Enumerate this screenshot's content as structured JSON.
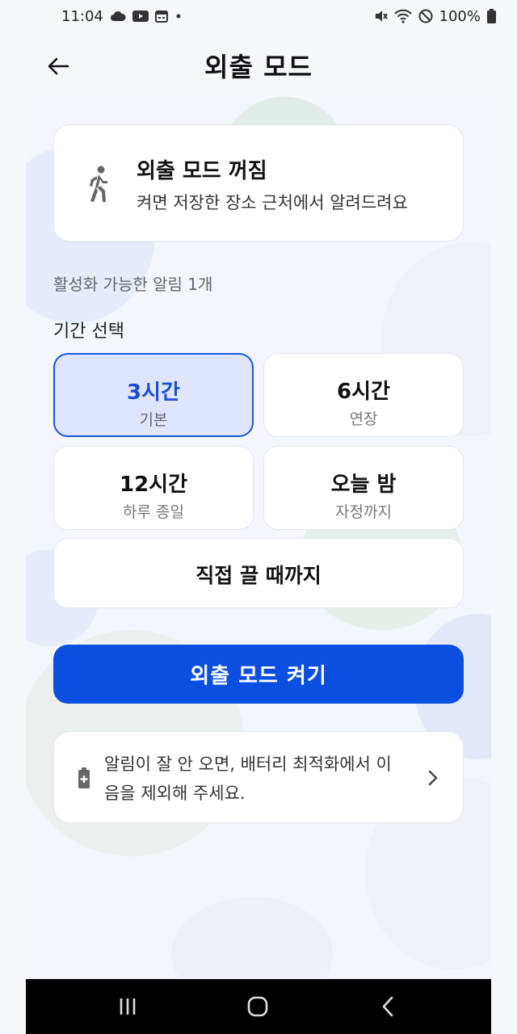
{
  "status_bar": {
    "time": "11:04",
    "left_icons": [
      "cloud-icon",
      "youtube-icon",
      "calendar-icon",
      "dot-icon"
    ],
    "right_icons": [
      "vibrate-off-icon",
      "wifi-icon",
      "do-not-disturb-icon",
      "battery-icon"
    ],
    "battery": "100%"
  },
  "header": {
    "title": "외출 모드",
    "back_icon": "arrow-left-icon"
  },
  "status_card": {
    "icon": "walking-person-icon",
    "title": "외출 모드 꺼짐",
    "description": "켜면 저장한 장소 근처에서 알려드려요"
  },
  "available_alerts": "활성화 가능한 알림 1개",
  "period": {
    "label": "기간 선택",
    "options": [
      {
        "main": "3시간",
        "sub": "기본",
        "selected": true
      },
      {
        "main": "6시간",
        "sub": "연장",
        "selected": false
      },
      {
        "main": "12시간",
        "sub": "하루 종일",
        "selected": false
      },
      {
        "main": "오늘 밤",
        "sub": "자정까지",
        "selected": false
      }
    ],
    "until_off": "직접 끌 때까지"
  },
  "primary_button": "외출 모드 켜기",
  "tip_card": {
    "icon": "battery-plus-icon",
    "line1": "알림이 잘 안 오면, 배터리 최적화에서 이",
    "line2": "음을 제외해 주세요.",
    "chevron": "chevron-right-icon"
  },
  "nav_bar": {
    "items": [
      "recent-apps-icon",
      "home-icon",
      "back-nav-icon"
    ]
  },
  "colors": {
    "accent": "#0a4fe0",
    "selected_bg": "#e0e5ff",
    "background": "#f5f7fb"
  }
}
